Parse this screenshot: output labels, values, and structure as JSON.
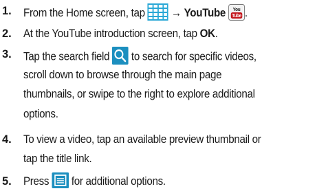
{
  "steps": [
    {
      "number": "1.",
      "lines": [
        {
          "pre": "From the Home screen, tap ",
          "arrow": "→",
          "bold": "YouTube",
          "post": "."
        }
      ],
      "icons": [
        "apps-grid-icon",
        "youtube-app-icon"
      ]
    },
    {
      "number": "2.",
      "lines": [
        {
          "pre": "At the YouTube introduction screen, tap ",
          "bold": "OK",
          "post": "."
        }
      ]
    },
    {
      "number": "3.",
      "lines": [
        {
          "pre": "Tap the search field ",
          "post": " to search for specific videos,"
        },
        {
          "text": "scroll down to browse through the main page"
        },
        {
          "text": "thumbnails, or swipe to the right to explore additional"
        },
        {
          "text": "options."
        }
      ],
      "icons": [
        "search-icon"
      ]
    },
    {
      "number": "4.",
      "lines": [
        {
          "text": "To view a video, tap an available preview thumbnail or"
        },
        {
          "text": "tap the title link."
        }
      ]
    },
    {
      "number": "5.",
      "lines": [
        {
          "pre": "Press ",
          "post": " for additional options."
        }
      ],
      "icons": [
        "menu-key-icon"
      ]
    }
  ],
  "youtube_icon_text": {
    "top": "You",
    "bottom": "Tube"
  },
  "colors": {
    "text": "#1a1a1a",
    "grid_icon": "#2aa8d6",
    "search_icon_bg": "#1c8fbf",
    "menu_icon_bg": "#1c8fbf",
    "youtube_red": "#c4161c"
  }
}
